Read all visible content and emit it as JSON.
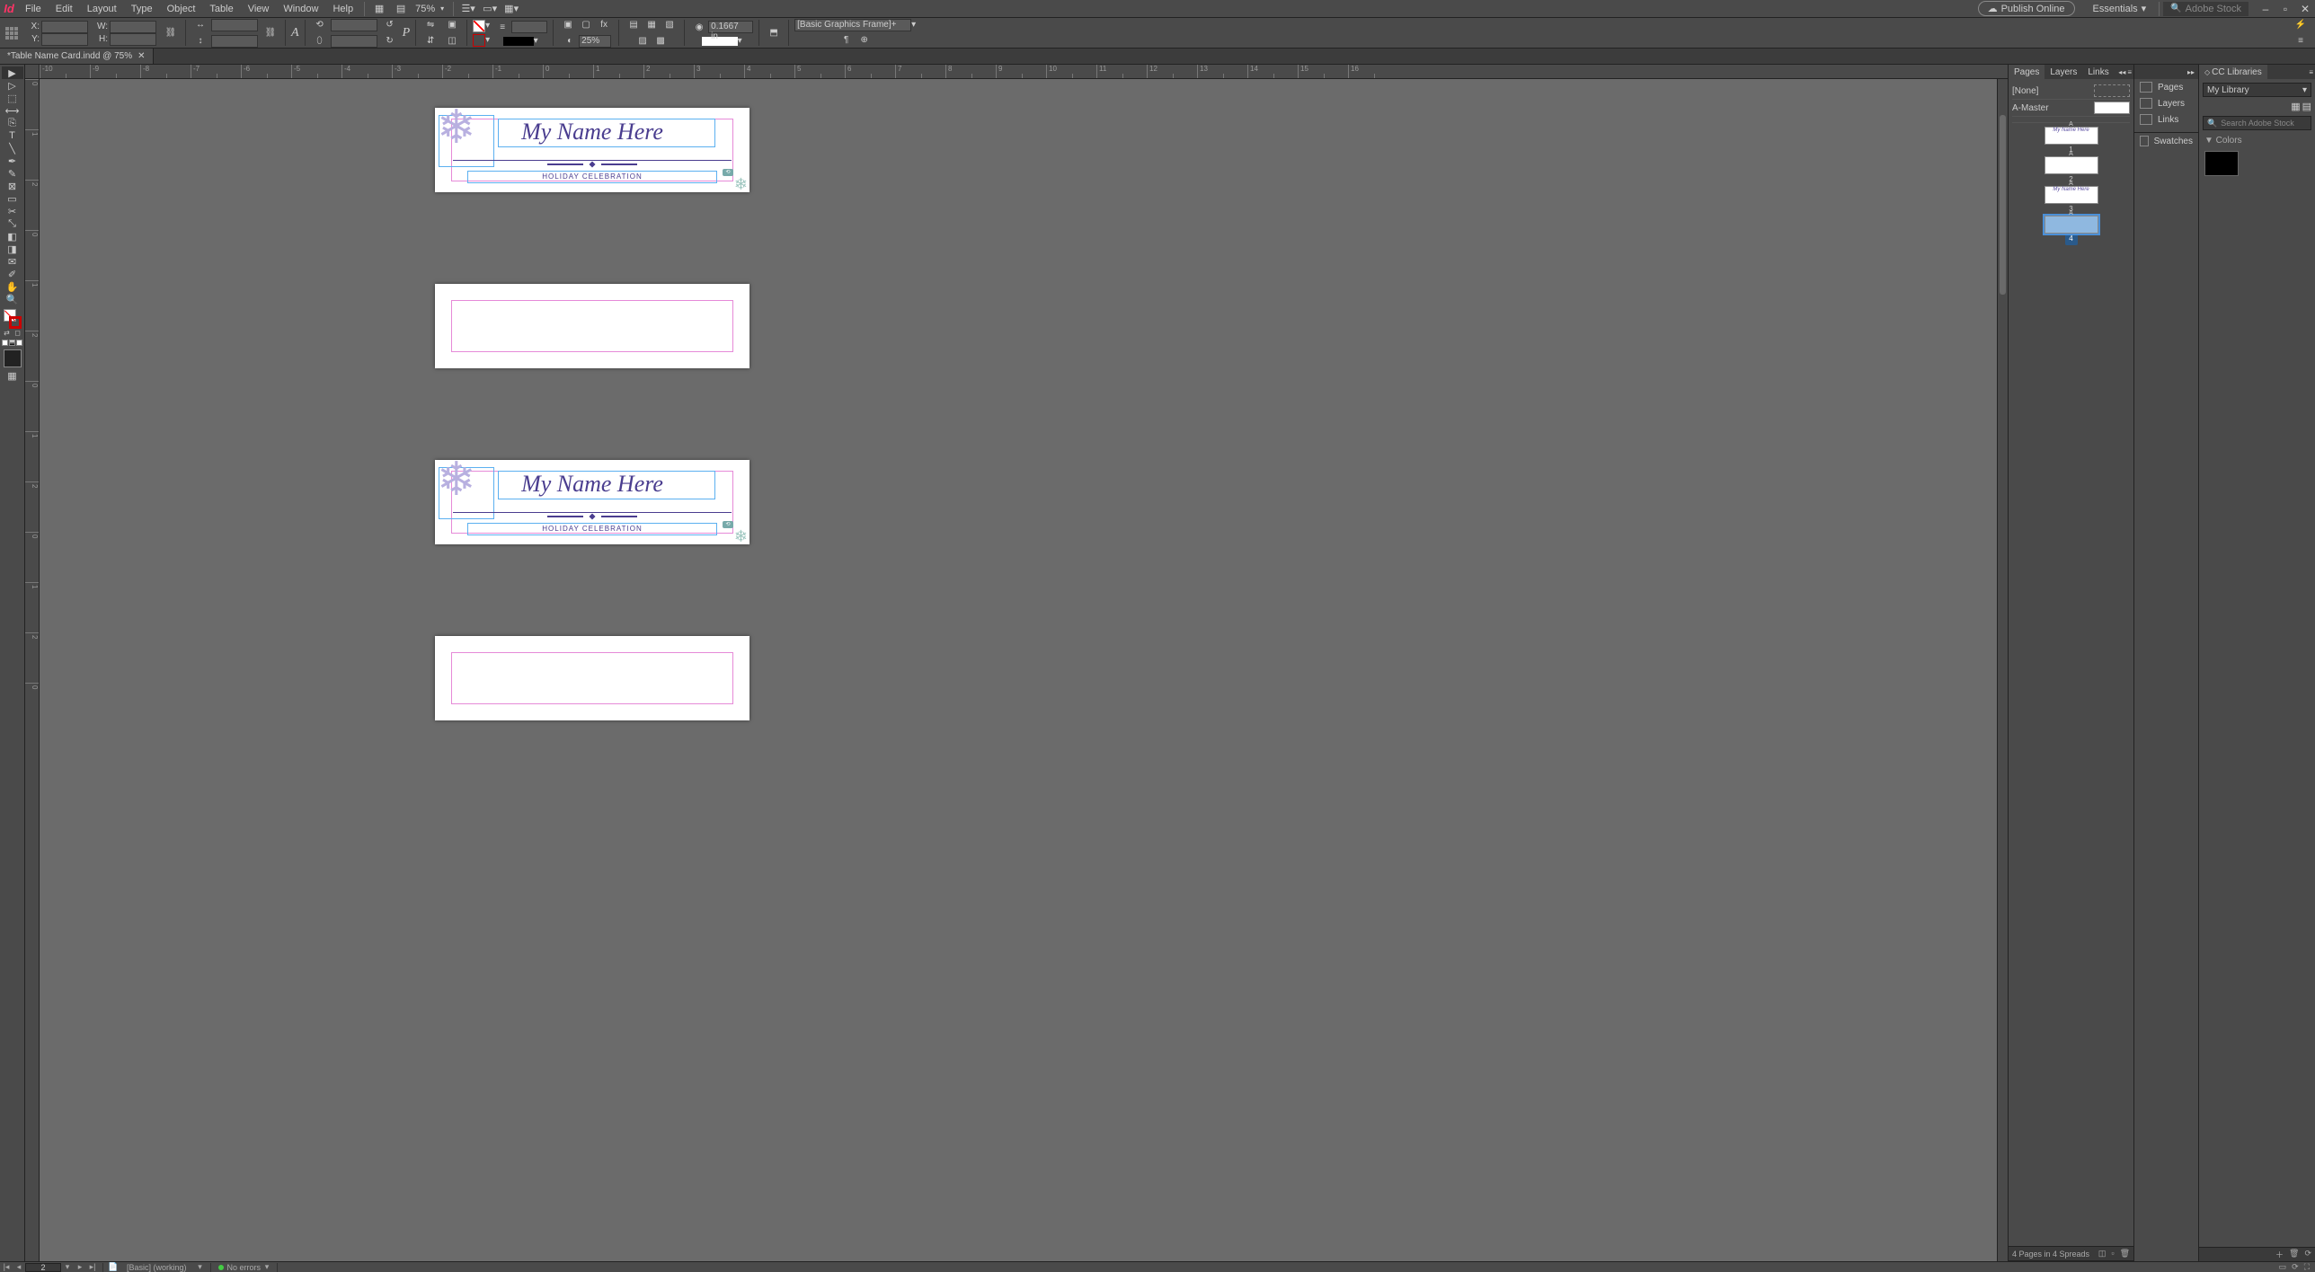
{
  "menu": {
    "items": [
      "File",
      "Edit",
      "Layout",
      "Type",
      "Object",
      "Table",
      "View",
      "Window",
      "Help"
    ],
    "zoom": "75%",
    "publish": "Publish Online",
    "workspace": "Essentials",
    "stock_placeholder": "Adobe Stock"
  },
  "control": {
    "x_label": "X:",
    "y_label": "Y:",
    "w_label": "W:",
    "h_label": "H:",
    "x": "",
    "y": "",
    "w": "",
    "h": "",
    "stroke_weight": "",
    "opacity": "25%",
    "stroke_pct": "25%",
    "corner_radius": "0.1667 in",
    "obj_style": "[Basic Graphics Frame]+",
    "p_icon": "P"
  },
  "doc_tab": {
    "title": "*Table Name Card.indd @ 75%"
  },
  "ruler_h": [
    "-10",
    "-9",
    "-8",
    "-7",
    "-6",
    "-5",
    "-4",
    "-3",
    "-2",
    "-1",
    "0",
    "1",
    "2",
    "3",
    "4",
    "5",
    "6",
    "7",
    "8",
    "9",
    "10",
    "11",
    "12",
    "13",
    "14",
    "15",
    "16"
  ],
  "ruler_v": [
    "0",
    "1",
    "2",
    "0",
    "1",
    "2",
    "0",
    "1",
    "2",
    "0",
    "1",
    "2",
    "0"
  ],
  "card": {
    "name": "My Name Here",
    "subtitle": "HOLIDAY CELEBRATION"
  },
  "panels": {
    "tabs_pages": [
      "Pages",
      "Layers",
      "Links"
    ],
    "none": "[None]",
    "amaster": "A-Master",
    "page_nums": [
      "1",
      "2",
      "3",
      "4"
    ],
    "page_letters": [
      "A",
      "A",
      "A",
      "A"
    ],
    "footer": "4 Pages in 4 Spreads",
    "narrow": [
      "Pages",
      "Layers",
      "Links",
      "Swatches"
    ],
    "cc_lib": "CC Libraries",
    "my_lib": "My Library",
    "lib_search_ph": "Search Adobe Stock",
    "colors_hdr": "▼ Colors"
  },
  "status": {
    "page": "2",
    "preset": "[Basic] (working)",
    "errors": "No errors"
  }
}
